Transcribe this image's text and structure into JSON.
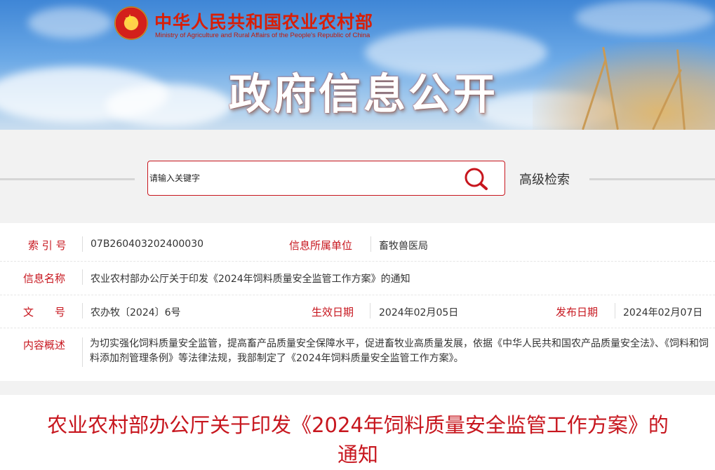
{
  "header": {
    "site_title": "中华人民共和国农业农村部",
    "site_subtitle": "Ministry of Agriculture and Rural Affairs of the People's Republic of China",
    "banner_title": "政府信息公开"
  },
  "search": {
    "placeholder": "请输入关键字",
    "advanced_label": "高级检索"
  },
  "meta": {
    "index_label": "索 引 号",
    "index_value": "07B260403202400030",
    "unit_label": "信息所属单位",
    "unit_value": "畜牧兽医局",
    "name_label": "信息名称",
    "name_value": "农业农村部办公厅关于印发《2024年饲料质量安全监管工作方案》的通知",
    "doc_label": "文　　号",
    "doc_value": "农办牧〔2024〕6号",
    "effective_label": "生效日期",
    "effective_value": "2024年02月05日",
    "publish_label": "发布日期",
    "publish_value": "2024年02月07日",
    "summary_label": "内容概述",
    "summary_value": "为切实强化饲料质量安全监管，提高畜产品质量安全保障水平，促进畜牧业高质量发展，依据《中华人民共和国农产品质量安全法》、《饲料和饲料添加剂管理条例》等法律法规，我部制定了《2024年饲料质量安全监管工作方案》。"
  },
  "article": {
    "title": "农业农村部办公厅关于印发《2024年饲料质量安全监管工作方案》的通知"
  },
  "colors": {
    "brand_red": "#c7161e",
    "banner_blue": "#3f86d6"
  },
  "icons": {
    "search": "search-icon",
    "emblem": "national-emblem-icon"
  }
}
